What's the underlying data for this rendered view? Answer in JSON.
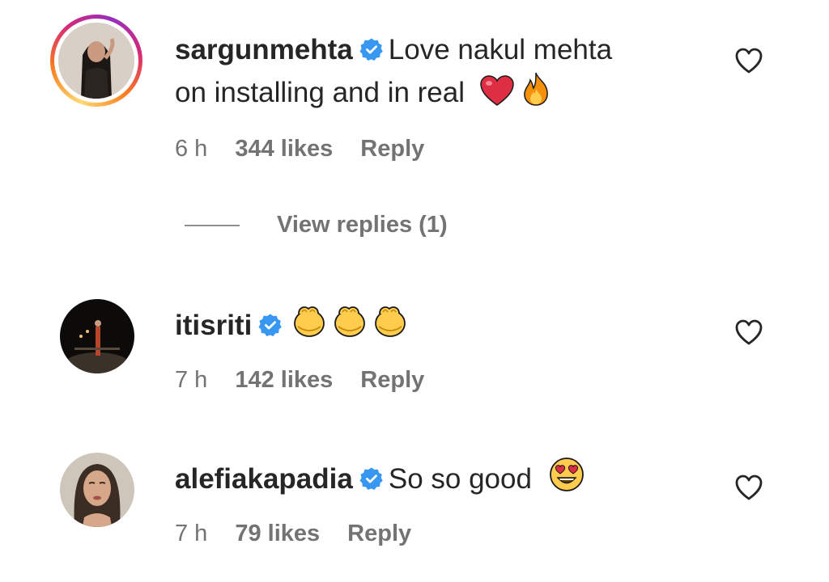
{
  "comments": [
    {
      "username": "sargunmehta",
      "text_line1": "Love nakul mehta",
      "text_line2": "on installing and in real",
      "emojis": [
        "red-heart",
        "fire"
      ],
      "time": "6 h",
      "likes": "344 likes",
      "reply_label": "Reply",
      "view_replies": "View replies (1)",
      "verified": true,
      "has_story_ring": true
    },
    {
      "username": "itisriti",
      "text": "",
      "emojis": [
        "clapping-hands",
        "clapping-hands",
        "clapping-hands"
      ],
      "time": "7 h",
      "likes": "142 likes",
      "reply_label": "Reply",
      "verified": true
    },
    {
      "username": "alefiakapadia",
      "text": "So so good",
      "emojis": [
        "heart-eyes"
      ],
      "time": "7 h",
      "likes": "79 likes",
      "reply_label": "Reply",
      "verified": true
    }
  ],
  "colors": {
    "verified": "#3897f0",
    "meta_text": "#737373",
    "primary_text": "#262626"
  }
}
